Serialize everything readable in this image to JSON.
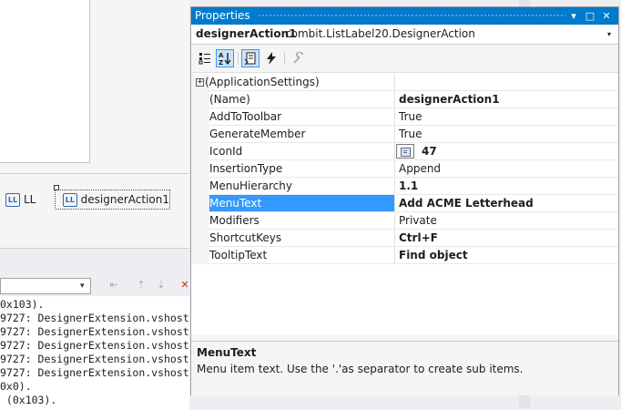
{
  "properties_window": {
    "title": "Properties",
    "object": {
      "name": "designerAction1",
      "type": "combit.ListLabel20.DesignerAction"
    },
    "rows": [
      {
        "name": "(ApplicationSettings)",
        "value": "",
        "expandable": true
      },
      {
        "name": "(Name)",
        "value": "designerAction1",
        "bold": true
      },
      {
        "name": "AddToToolbar",
        "value": "True"
      },
      {
        "name": "GenerateMember",
        "value": "True"
      },
      {
        "name": "IconId",
        "value": "47",
        "bold": true
      },
      {
        "name": "InsertionType",
        "value": "Append"
      },
      {
        "name": "MenuHierarchy",
        "value": "1.1",
        "bold": true
      },
      {
        "name": "MenuText",
        "value": "Add ACME Letterhead",
        "bold": true,
        "selected": true
      },
      {
        "name": "Modifiers",
        "value": "Private"
      },
      {
        "name": "ShortcutKeys",
        "value": "Ctrl+F",
        "bold": true
      },
      {
        "name": "TooltipText",
        "value": "Find object",
        "bold": true
      }
    ],
    "description": {
      "title": "MenuText",
      "text": "Menu item text. Use the '.'as separator to create sub items."
    },
    "expand_glyph": "+",
    "title_buttons": {
      "dropdown": "▾",
      "maximize": "□",
      "close": "✕"
    },
    "combo_arrow": "▾"
  },
  "tray": {
    "items": [
      {
        "label": "LL",
        "icon": "LL"
      },
      {
        "label": "designerAction1",
        "icon": "LL"
      }
    ]
  },
  "output": {
    "lines": [
      "0x103).",
      "9727: DesignerExtension.vshost",
      "9727: DesignerExtension.vshost",
      "9727: DesignerExtension.vshost",
      "9727: DesignerExtension.vshost",
      "9727: DesignerExtension.vshost",
      "0x0).",
      " (0x103)."
    ]
  },
  "colors": {
    "accent": "#007acc",
    "selection": "#3399ff"
  }
}
